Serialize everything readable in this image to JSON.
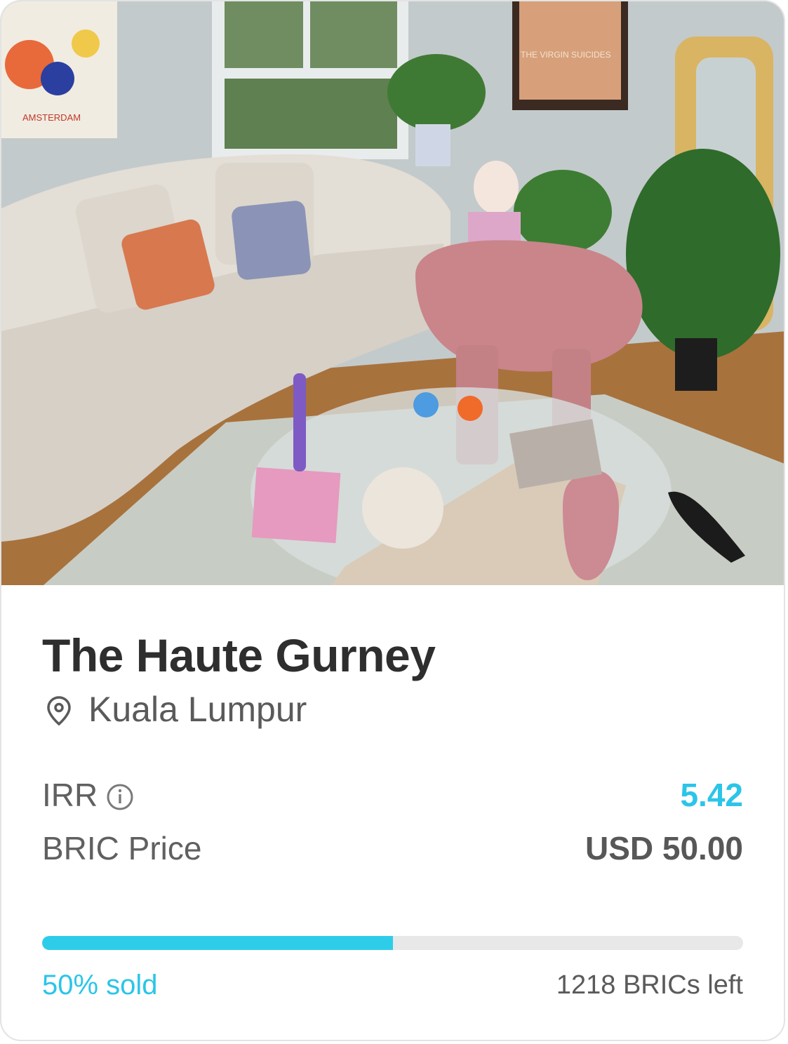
{
  "property": {
    "image_label": "photo",
    "poster_left_text": "AMSTERDAM",
    "poster_right_text": "THE VIRGIN SUICIDES",
    "title": "The Haute Gurney",
    "location": "Kuala Lumpur",
    "irr_label": "IRR",
    "irr_value": "5.42",
    "bric_price_label": "BRIC Price",
    "bric_price_value": "USD 50.00",
    "sold_text": "50% sold",
    "sold_fraction": 0.5,
    "remaining_text": "1218 BRICs left"
  },
  "icons": {
    "location": "map-pin-icon",
    "info": "info-icon"
  },
  "colors": {
    "accent": "#2bc5e8",
    "progress_fill": "#2dcdea",
    "progress_track": "#e8e8e8",
    "title": "#2e2e2e",
    "secondary_text": "#5a5a5a"
  }
}
